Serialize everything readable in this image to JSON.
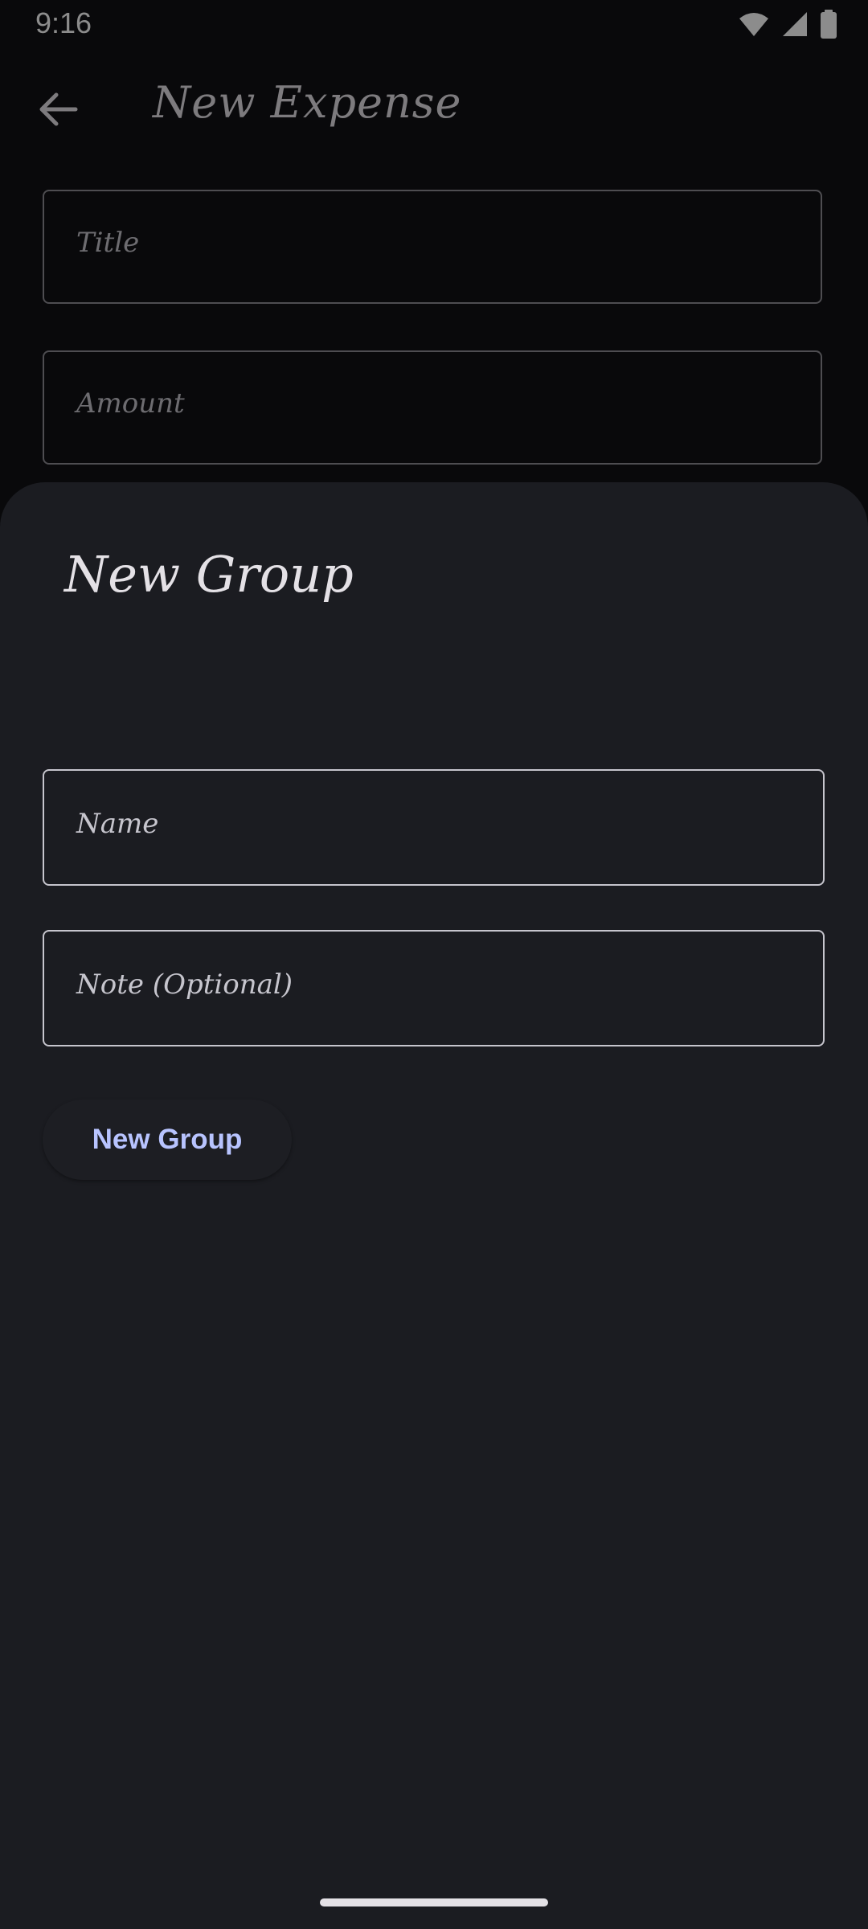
{
  "status_bar": {
    "time": "9:16",
    "icons": [
      "wifi-icon",
      "signal-icon",
      "battery-icon"
    ]
  },
  "background_screen": {
    "title": "New Expense",
    "back_icon": "arrow-back-icon",
    "fields": [
      {
        "placeholder": "Title"
      },
      {
        "placeholder": "Amount"
      }
    ]
  },
  "sheet": {
    "title": "New Group",
    "name_field": {
      "placeholder": "Name"
    },
    "note_field": {
      "placeholder": "Note (Optional)"
    },
    "submit_label": "New Group"
  },
  "colors": {
    "background": "#111215",
    "sheet": "#1b1c21",
    "accent": "#b8c4ff",
    "outline": "#c6c5cd"
  }
}
